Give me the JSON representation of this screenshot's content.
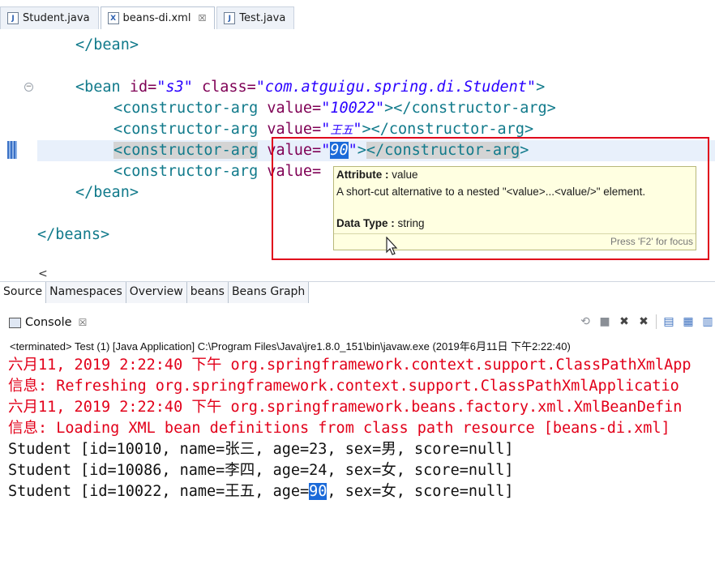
{
  "editor_tabs": [
    {
      "label": "Student.java",
      "icon": "java-file-icon"
    },
    {
      "label": "beans-di.xml",
      "icon": "xml-file-icon",
      "close": "☒"
    },
    {
      "label": "Test.java",
      "icon": "java-file-icon"
    }
  ],
  "code": {
    "line1": "</bean>",
    "bean_open": "<bean",
    "attr_id": " id=",
    "id_val": "\"s3\"",
    "attr_class": " class=",
    "class_val": "\"com.atguigu.spring.di.Student\"",
    "gt": ">",
    "ctor_open": "<constructor-arg",
    "attr_value": " value=",
    "v1": "\"10022\"",
    "v2_q1": "\"",
    "v2": "王五",
    "v2_q2": "\"",
    "v3_q1": "\"",
    "v3": "90",
    "v3_q2": "\"",
    "ctor_close": "></constructor-arg>",
    "ctor_close_a": ">",
    "ctor_close_b": "</constructor-arg",
    "ctor_close_c": ">",
    "v4_part": " value=",
    "bean_close": "</bean>",
    "beans_close": "</beans>"
  },
  "tooltip": {
    "attr_label": "Attribute :",
    "attr_value": " value",
    "desc": "A short-cut alternative to a nested \"<value>...<value/>\" element.",
    "type_label": "Data Type :",
    "type_value": " string",
    "footer": "Press 'F2' for focus"
  },
  "editor_subtabs": [
    "Source",
    "Namespaces",
    "Overview",
    "beans",
    "Beans Graph"
  ],
  "console": {
    "title": "Console",
    "close": "☒",
    "status": "<terminated> Test (1) [Java Application] C:\\Program Files\\Java\\jre1.8.0_151\\bin\\javaw.exe (2019年6月11日 下午2:22:40)",
    "lines": [
      {
        "text": "六月11, 2019 2:22:40 下午 org.springframework.context.support.ClassPathXmlApp"
      },
      {
        "text": "信息: Refreshing org.springframework.context.support.ClassPathXmlApplicatio"
      },
      {
        "text": "六月11, 2019 2:22:40 下午 org.springframework.beans.factory.xml.XmlBeanDefin"
      },
      {
        "text": "信息: Loading XML bean definitions from class path resource [beans-di.xml]"
      },
      {
        "text": "Student [id=10010, name=张三, age=23, sex=男, score=null]"
      },
      {
        "text": "Student [id=10086, name=李四, age=24, sex=女, score=null]"
      }
    ],
    "last_line": {
      "prefix": "Student [id=10022, name=王五, age=",
      "highlight": "90",
      "suffix": ", sex=女, score=null]"
    }
  },
  "colors": {
    "console_red": "#e2001a",
    "xml_tag": "#117a8b",
    "xml_attr": "#7f0055",
    "xml_string": "#2a00ff",
    "selection": "#1b6ad9",
    "tooltip_bg": "#ffffe1",
    "callout_border": "#e0001b"
  }
}
